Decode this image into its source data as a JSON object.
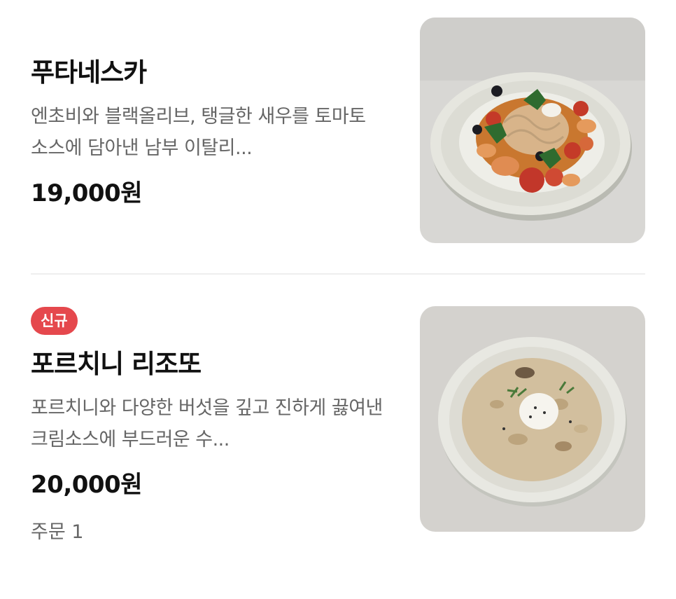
{
  "menu": {
    "items": [
      {
        "name": "푸타네스카",
        "description": "엔초비와 블랙올리브, 탱글한 새우를 토마토 소스에 담아낸 남부 이탈리...",
        "price": "19,000원"
      },
      {
        "badge": "신규",
        "name": "포르치니 리조또",
        "description": "포르치니와 다양한 버섯을 깊고 진하게 끓여낸 크림소스에 부드러운 수...",
        "price": "20,000원",
        "orders": "주문 1"
      }
    ]
  },
  "colors": {
    "badge_bg": "#e5484d",
    "text_primary": "#111111",
    "text_secondary": "#666666",
    "divider": "#eeeeee"
  }
}
